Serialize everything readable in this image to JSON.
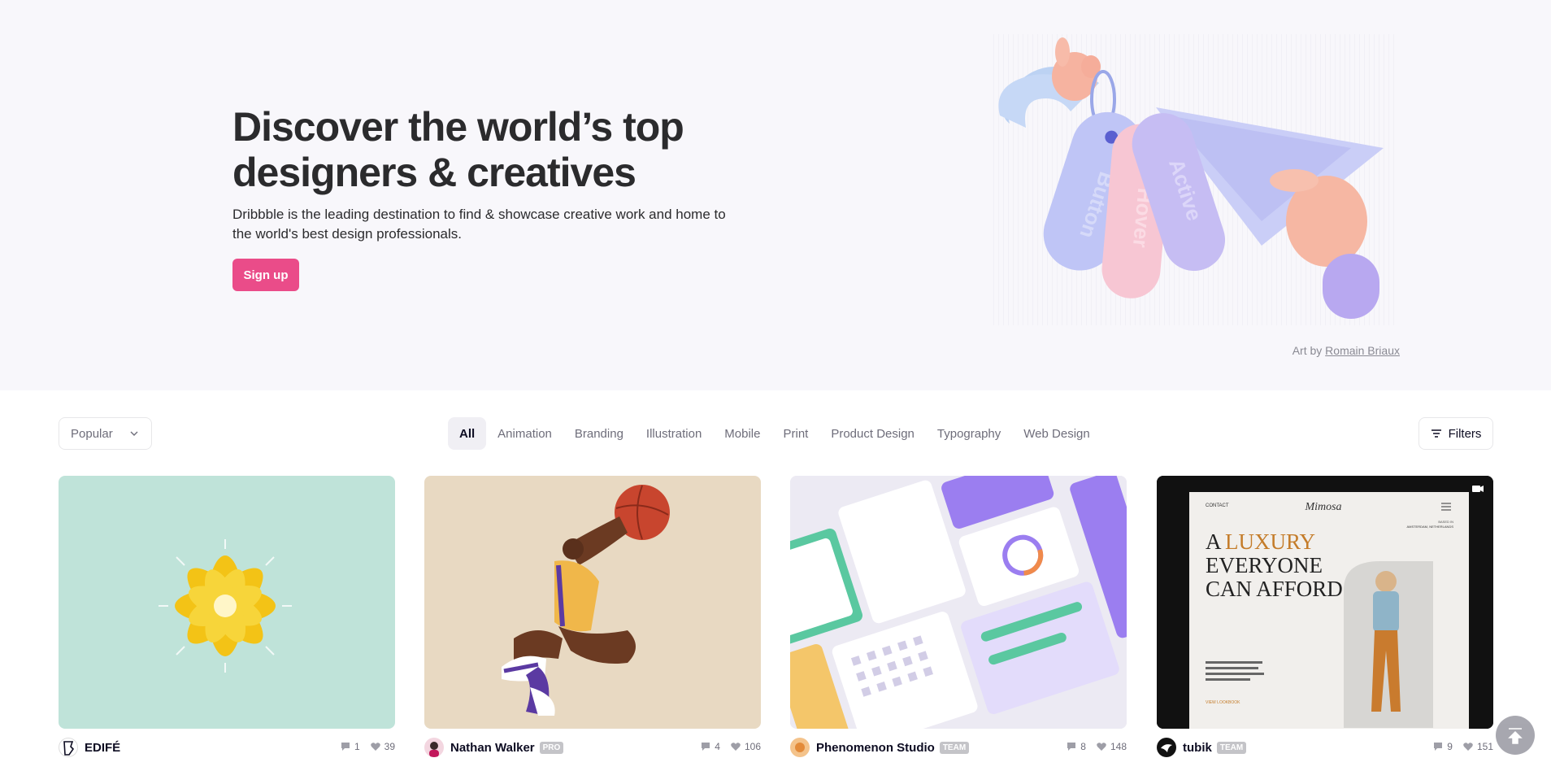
{
  "hero": {
    "title": "Discover the world’s top designers & creatives",
    "subtitle": "Dribbble is the leading destination to find & showcase creative work and home to the world's best design professionals.",
    "signup_label": "Sign up",
    "art_tags": [
      "Button",
      "Hover",
      "Active"
    ],
    "art_credit_prefix": "Art by",
    "art_credit_author": "Romain Briaux"
  },
  "filters": {
    "sort_selected": "Popular",
    "categories": [
      "All",
      "Animation",
      "Branding",
      "Illustration",
      "Mobile",
      "Print",
      "Product Design",
      "Typography",
      "Web Design"
    ],
    "active_category": "All",
    "filters_label": "Filters"
  },
  "shots": [
    {
      "author": "EDIFÉ",
      "badge": "",
      "comments": "1",
      "likes": "39",
      "thumb_bg": "#bfe3d9"
    },
    {
      "author": "Nathan Walker",
      "badge": "PRO",
      "comments": "4",
      "likes": "106",
      "thumb_bg": "#e8d9c2"
    },
    {
      "author": "Phenomenon Studio",
      "badge": "TEAM",
      "comments": "8",
      "likes": "148",
      "thumb_bg": "#eceaf3"
    },
    {
      "author": "tubik",
      "badge": "TEAM",
      "comments": "9",
      "likes": "151",
      "thumb_bg": "#111111",
      "mock": {
        "nav_contact": "CONTACT",
        "brand": "Mimosa",
        "location_top": "BASED IN",
        "location": "AMSTERDAM, NETHERLANDS",
        "headline_1": "A",
        "headline_accent": "LUXURY",
        "headline_2": "EVERYONE",
        "headline_3": "CAN AFFORD",
        "cta": "VIEW LOOKBOOK"
      }
    }
  ],
  "colors": {
    "brand_pink": "#ea4c89",
    "hero_bg": "#f8f7fb",
    "text_dark": "#2b2b2d",
    "muted": "#6e6d7a"
  }
}
